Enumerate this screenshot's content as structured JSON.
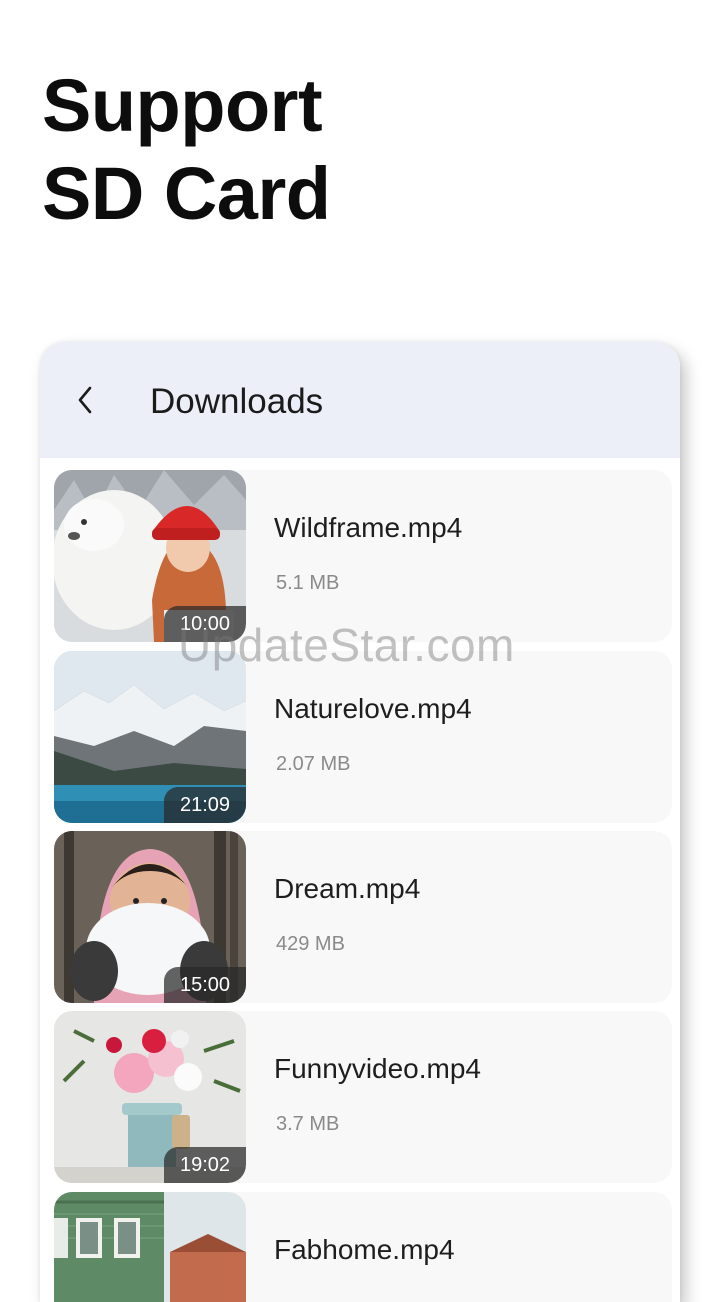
{
  "headline": {
    "line1": "Support",
    "line2": "SD Card"
  },
  "app_bar": {
    "title": "Downloads",
    "back_icon": "chevron-left-icon"
  },
  "files": [
    {
      "name": "Wildframe.mp4",
      "size": "5.1 MB",
      "duration": "10:00",
      "thumbnail": "woman-with-dog-snow"
    },
    {
      "name": "Naturelove.mp4",
      "size": "2.07 MB",
      "duration": "21:09",
      "thumbnail": "mountain-lake"
    },
    {
      "name": "Dream.mp4",
      "size": "429 MB",
      "duration": "15:00",
      "thumbnail": "child-holding-snow"
    },
    {
      "name": "Funnyvideo.mp4",
      "size": "3.7 MB",
      "duration": "19:02",
      "thumbnail": "flower-vase"
    },
    {
      "name": "Fabhome.mp4",
      "size": "",
      "duration": "",
      "thumbnail": "green-house"
    }
  ],
  "watermark": "UpdateStar.com",
  "colors": {
    "app_bar_bg": "#eceff8",
    "item_bg": "#f8f8f8",
    "duration_badge": "#282828",
    "size_text": "#8a8a8a"
  }
}
